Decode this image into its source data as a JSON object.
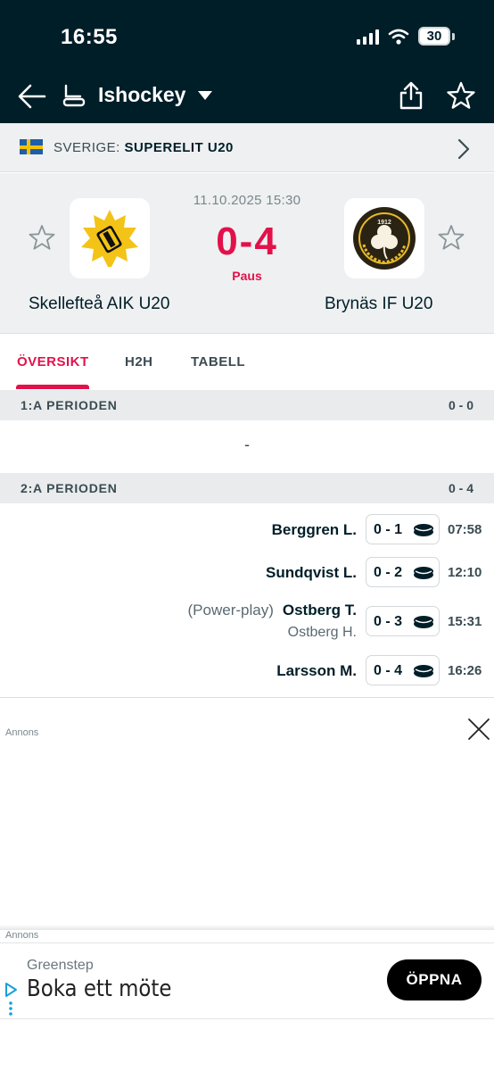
{
  "status_bar": {
    "time": "16:55",
    "battery": "30"
  },
  "header": {
    "sport": "Ishockey"
  },
  "league": {
    "country": "SVERIGE:",
    "name": "SUPERELIT U20"
  },
  "match": {
    "datetime": "11.10.2025 15:30",
    "score": "0-4",
    "status": "Paus",
    "home_team": "Skellefteå AIK U20",
    "away_team": "Brynäs IF U20",
    "away_logo_year": "1912"
  },
  "tabs": [
    "ÖVERSIKT",
    "H2H",
    "TABELL"
  ],
  "periods": [
    {
      "label": "1:A PERIODEN",
      "score": "0 - 0",
      "empty": "-"
    },
    {
      "label": "2:A PERIODEN",
      "score": "0 - 4"
    }
  ],
  "events": [
    {
      "player": "Berggren L.",
      "score": "0 - 1",
      "time": "07:58"
    },
    {
      "player": "Sundqvist L.",
      "score": "0 - 2",
      "time": "12:10"
    },
    {
      "note": "(Power-play)",
      "player": "Ostberg T.",
      "assist": "Ostberg H.",
      "score": "0 - 3",
      "time": "15:31"
    },
    {
      "player": "Larsson M.",
      "score": "0 - 4",
      "time": "16:26"
    }
  ],
  "ads": {
    "label": "Annons",
    "label2": "Annons",
    "brand": "Greenstep",
    "headline": "Boka ett möte",
    "cta": "ÖPPNA"
  },
  "colors": {
    "header_bg": "#001e28",
    "accent": "#e2114a",
    "section_bg": "#eef0f1"
  }
}
